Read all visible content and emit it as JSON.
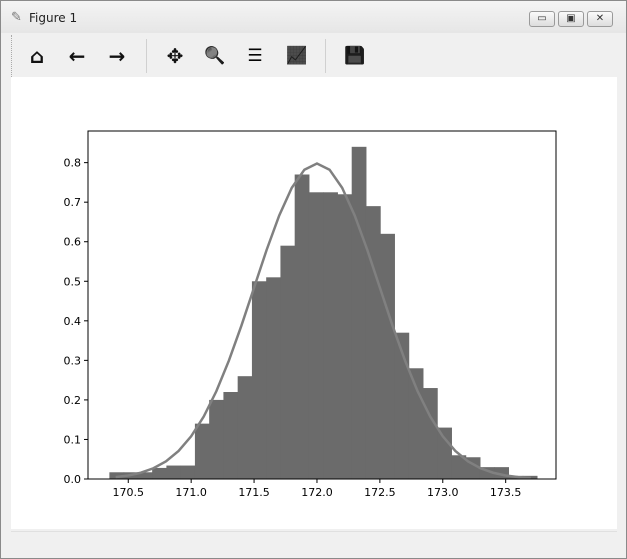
{
  "window": {
    "title": "Figure 1",
    "app_icon": "matplotlib-icon",
    "controls": [
      "minimize",
      "restore",
      "close"
    ]
  },
  "toolbar": {
    "buttons": [
      {
        "name": "home",
        "icon": "home-icon",
        "glyph": "⌂"
      },
      {
        "name": "back",
        "icon": "arrow-left-icon",
        "glyph": "←"
      },
      {
        "name": "forward",
        "icon": "arrow-right-icon",
        "glyph": "→"
      },
      {
        "name": "pan",
        "icon": "move-icon",
        "glyph": "✥"
      },
      {
        "name": "zoom",
        "icon": "magnifier-icon",
        "glyph": "🔍"
      },
      {
        "name": "configure-subplots",
        "icon": "sliders-icon",
        "glyph": "☰"
      },
      {
        "name": "edit-axes",
        "icon": "line-chart-icon",
        "glyph": "📈"
      },
      {
        "name": "save",
        "icon": "floppy-disk-icon",
        "glyph": "💾"
      }
    ]
  },
  "chart_data": {
    "type": "bar",
    "title": "",
    "xlabel": "",
    "ylabel": "",
    "xlim": [
      170.18,
      173.9
    ],
    "ylim": [
      0,
      0.88
    ],
    "xticks": [
      170.5,
      171.0,
      171.5,
      172.0,
      172.5,
      173.0,
      173.5
    ],
    "xtick_labels": [
      "170.5",
      "171.0",
      "171.5",
      "172.0",
      "172.5",
      "173.0",
      "173.5"
    ],
    "yticks": [
      0,
      0.1,
      0.2,
      0.3,
      0.4,
      0.5,
      0.6,
      0.7,
      0.8
    ],
    "ytick_labels": [
      "0.0",
      "0.1",
      "0.2",
      "0.3",
      "0.4",
      "0.5",
      "0.6",
      "0.7",
      "0.8"
    ],
    "bar_color": "#6b6b6b",
    "line_color": "#808080",
    "histogram": {
      "start": 170.35,
      "bin_width": 0.1133,
      "values": [
        0.017,
        0.017,
        0.017,
        0.028,
        0.034,
        0.034,
        0.14,
        0.2,
        0.22,
        0.26,
        0.5,
        0.51,
        0.59,
        0.77,
        0.725,
        0.725,
        0.72,
        0.84,
        0.69,
        0.62,
        0.37,
        0.28,
        0.23,
        0.13,
        0.06,
        0.055,
        0.03,
        0.03,
        0.008,
        0.008
      ]
    },
    "density_curve": {
      "mean": 172.0,
      "std": 0.5,
      "x_start": 170.4,
      "x_end": 173.7,
      "step": 0.1
    }
  }
}
